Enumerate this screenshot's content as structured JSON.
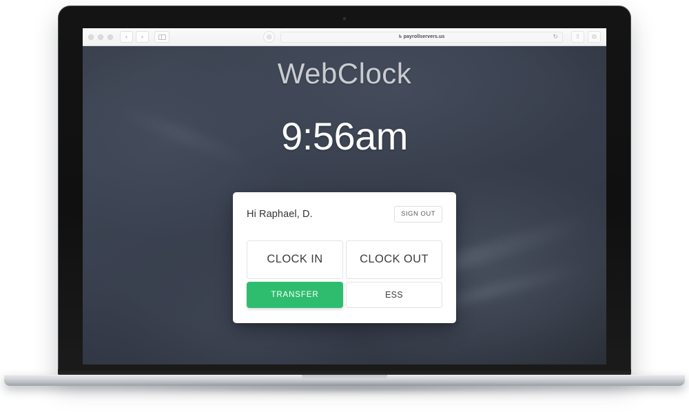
{
  "browser": {
    "url": "payrollservers.us",
    "lock_icon": "lock-icon",
    "reload_icon": "↻",
    "back_icon": "‹",
    "forward_icon": "›",
    "sidebar_icon": "sidebar-icon",
    "shield_icon": "◎",
    "share_icon": "⇧",
    "tabs_icon": "⧉",
    "traffic_lights": [
      "close",
      "minimize",
      "zoom"
    ]
  },
  "page": {
    "brand": "WebClock",
    "time": "9:56am"
  },
  "card": {
    "greeting": "Hi Raphael, D.",
    "sign_out_label": "SIGN OUT",
    "buttons": {
      "clock_in": "CLOCK IN",
      "clock_out": "CLOCK OUT",
      "transfer": "TRANSFER",
      "ess": "ESS"
    }
  },
  "colors": {
    "accent_green": "#2ebd6e",
    "page_background": "#3a4150",
    "card_background": "#ffffff",
    "brand_text": "#c9ccd2",
    "time_text": "#ffffff"
  }
}
